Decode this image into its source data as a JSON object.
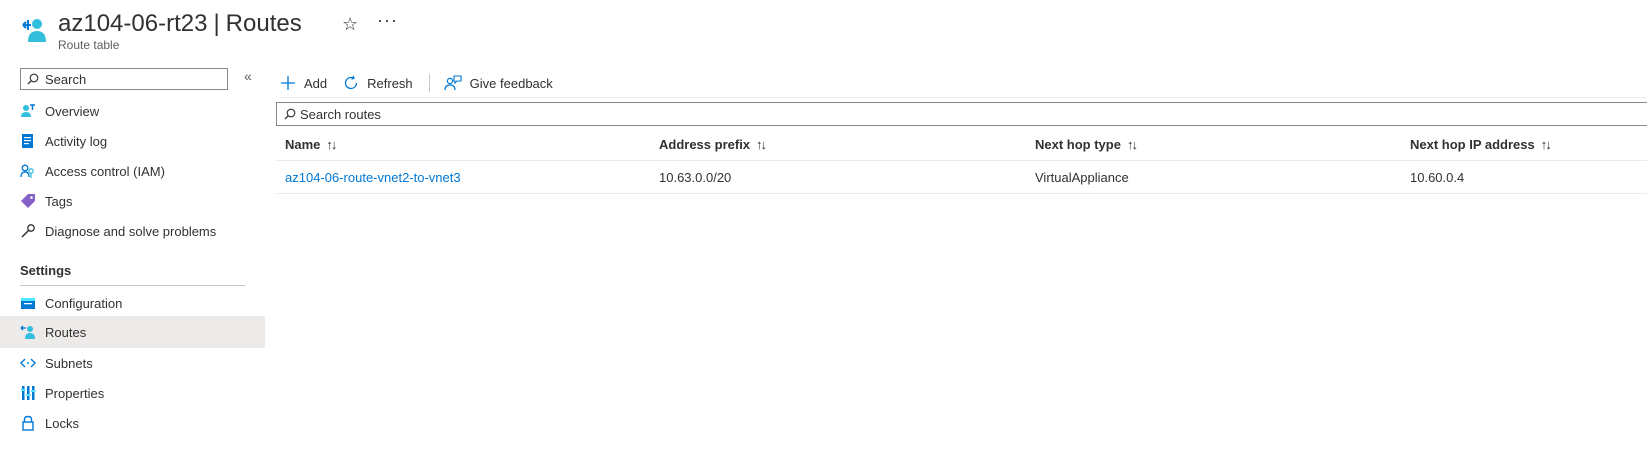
{
  "header": {
    "resource_name": "az104-06-rt23",
    "separator": "|",
    "page_name": "Routes",
    "resource_type": "Route table",
    "favorite_icon": "star-icon",
    "more_icon": "ellipsis-icon"
  },
  "sidebar": {
    "search_placeholder": "Search",
    "collapse_label": "«",
    "items": [
      {
        "label": "Overview",
        "icon": "overview-icon"
      },
      {
        "label": "Activity log",
        "icon": "activity-log-icon"
      },
      {
        "label": "Access control (IAM)",
        "icon": "iam-icon"
      },
      {
        "label": "Tags",
        "icon": "tag-icon"
      },
      {
        "label": "Diagnose and solve problems",
        "icon": "wrench-icon"
      }
    ],
    "settings_title": "Settings",
    "settings_items": [
      {
        "label": "Configuration",
        "icon": "configuration-icon"
      },
      {
        "label": "Routes",
        "icon": "routes-icon",
        "active": true
      },
      {
        "label": "Subnets",
        "icon": "subnets-icon"
      },
      {
        "label": "Properties",
        "icon": "properties-icon"
      },
      {
        "label": "Locks",
        "icon": "lock-icon"
      }
    ]
  },
  "toolbar": {
    "add_label": "Add",
    "refresh_label": "Refresh",
    "feedback_label": "Give feedback"
  },
  "routes": {
    "search_placeholder": "Search routes",
    "columns": [
      "Name",
      "Address prefix",
      "Next hop type",
      "Next hop IP address"
    ],
    "sort_glyph": "↑↓",
    "rows": [
      {
        "name": "az104-06-route-vnet2-to-vnet3",
        "address_prefix": "10.63.0.0/20",
        "next_hop_type": "VirtualAppliance",
        "next_hop_ip": "10.60.0.4"
      }
    ]
  },
  "colors": {
    "accent": "#0078d4",
    "active_bg": "#edebe9",
    "text": "#323130"
  }
}
